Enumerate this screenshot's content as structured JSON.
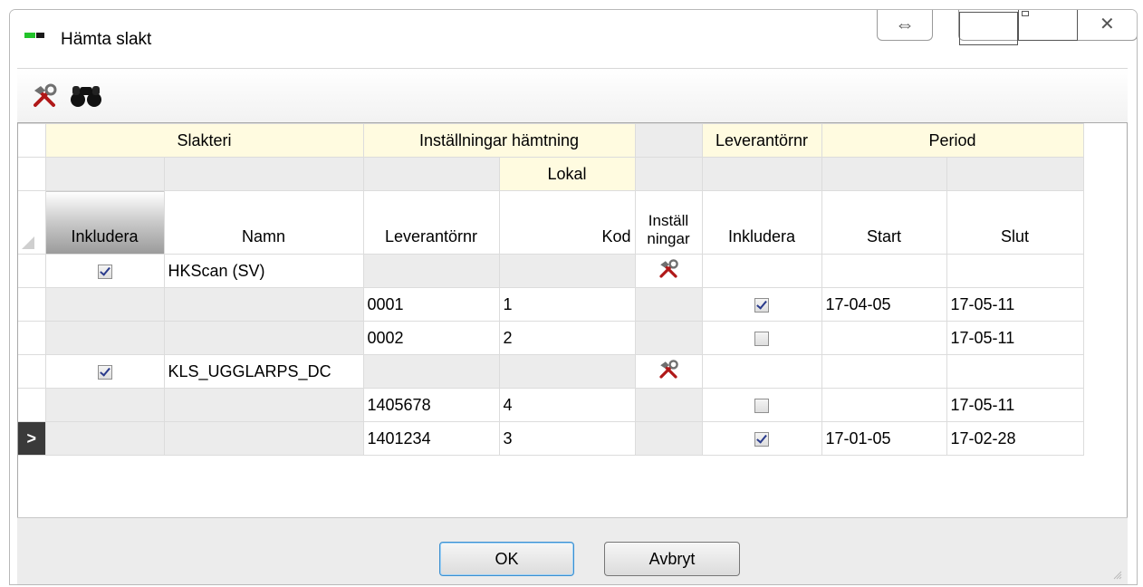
{
  "window": {
    "title": "Hämta slakt"
  },
  "titlebar": {
    "resize_icon": "⇔",
    "close_icon": "✕"
  },
  "toolbar": {
    "tools": [
      "settings-tools-icon",
      "binoculars-icon"
    ]
  },
  "grid": {
    "group_headers": [
      "Slakteri",
      "Inställningar hämtning",
      "Leverantörnr",
      "Period"
    ],
    "sub_header_lokal": "Lokal",
    "columns": [
      "Inkludera",
      "Namn",
      "Leverantörnr",
      "Kod",
      "Inställ ningar",
      "Inkludera",
      "Start",
      "Slut"
    ],
    "rows": [
      {
        "type": "parent",
        "include": true,
        "name": "HKScan (SV)",
        "lev": "",
        "kod": "",
        "settings": true,
        "lev_include": null,
        "start": "",
        "slut": ""
      },
      {
        "type": "child",
        "include": null,
        "name": "",
        "lev": "0001",
        "kod": "1",
        "settings": false,
        "lev_include": true,
        "start": "17-04-05",
        "slut": "17-05-11"
      },
      {
        "type": "child",
        "include": null,
        "name": "",
        "lev": "0002",
        "kod": "2",
        "settings": false,
        "lev_include": false,
        "start": "",
        "slut": "17-05-11"
      },
      {
        "type": "parent",
        "include": true,
        "name": "KLS_UGGLARPS_DC",
        "lev": "",
        "kod": "",
        "settings": true,
        "lev_include": null,
        "start": "",
        "slut": ""
      },
      {
        "type": "child",
        "include": null,
        "name": "",
        "lev": "1405678",
        "kod": "4",
        "settings": false,
        "lev_include": false,
        "start": "",
        "slut": "17-05-11"
      },
      {
        "type": "child",
        "include": null,
        "name": "",
        "lev": "1401234",
        "kod": "3",
        "settings": false,
        "lev_include": true,
        "start": "17-01-05",
        "slut": "17-02-28",
        "current": true
      }
    ],
    "current_row_marker": ">"
  },
  "footer": {
    "ok_label": "OK",
    "cancel_label": "Avbryt"
  },
  "colors": {
    "header_yellow": "#fffbe0",
    "row_gray": "#ececec",
    "ok_focus": "#3b8fd0"
  }
}
